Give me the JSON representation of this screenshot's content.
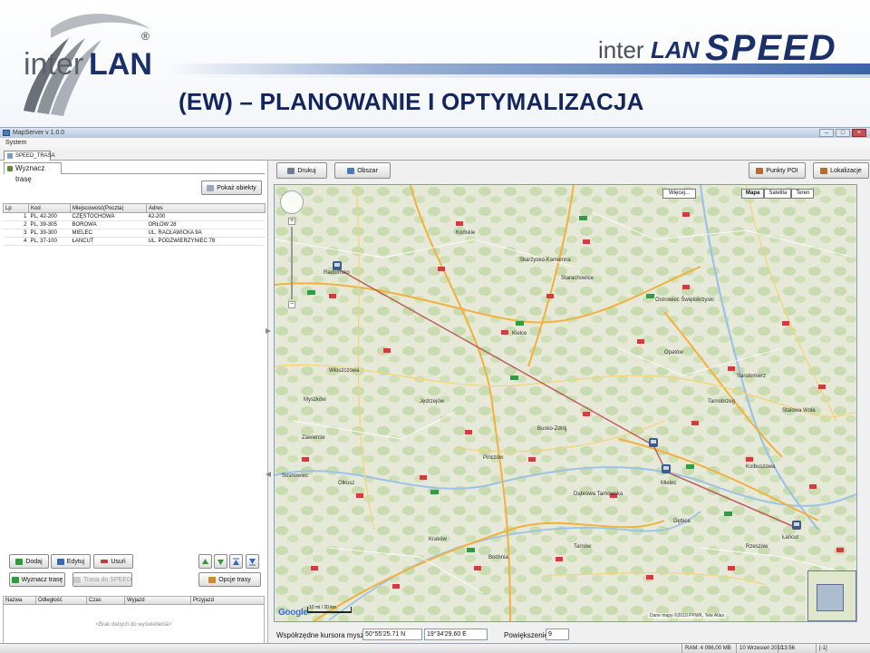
{
  "slide": {
    "title": "(EW) – PLANOWANIE I OPTYMALIZACJA",
    "logo_left_text": "interLAN",
    "logo_left_registered": "®",
    "logo_right_text": "interLAN SPEED"
  },
  "window": {
    "title": "MapServer v 1.0.0",
    "menu": "System",
    "tab": "SPEED_TRASA"
  },
  "left_panel": {
    "tab_label": "Wyznacz trasę",
    "show_objects_label": "Pokaż obiekty",
    "table": {
      "columns": [
        "Lp",
        "Kod",
        "Miejscowość(Poczta)",
        "Adres"
      ],
      "rows": [
        [
          "1",
          "PL, 42-200",
          "CZĘSTOCHOWA",
          "42-200"
        ],
        [
          "2",
          "PL, 39-305",
          "BOROWA",
          "ORŁÓW 28"
        ],
        [
          "3",
          "PL, 39-300",
          "MIELEC",
          "UL. RACŁAWICKA 9A"
        ],
        [
          "4",
          "PL, 37-100",
          "ŁAŃCUT",
          "UL. PODZWIERZYNIEC 78"
        ]
      ]
    },
    "buttons": {
      "add": "Dodaj",
      "edit": "Edytuj",
      "delete": "Usuń",
      "plan_route": "Wyznacz trasę",
      "send_route": "Trasa do SPEED",
      "route_options": "Opcje trasy"
    },
    "results": {
      "columns": [
        "Nazwa",
        "Odległość",
        "Czas",
        "Wyjazd",
        "Przyjazd"
      ],
      "empty_text": "<Brak danych do wyświetlenia>"
    }
  },
  "map_toolbar": {
    "print": "Drukuj",
    "view": "Obszar",
    "poi": "Punkty POI",
    "locate": "Lokalizacje"
  },
  "map": {
    "label_box": "Więcej...",
    "types": [
      "Mapa",
      "Satelita",
      "Teren"
    ],
    "active_type": "Mapa",
    "google": "Google",
    "copyright": "Dane mapy ©2010 PPWK, Tele Atlas",
    "scale": "10 mi / 20 km",
    "cities": [
      {
        "name": "Radomsko"
      },
      {
        "name": "Kielce"
      },
      {
        "name": "Ostrowiec Świętokrzyski"
      },
      {
        "name": "Sandomierz"
      },
      {
        "name": "Tarnobrzeg"
      },
      {
        "name": "Mielec"
      },
      {
        "name": "Rzeszów"
      },
      {
        "name": "Łańcut"
      },
      {
        "name": "Kraków"
      },
      {
        "name": "Tarnów"
      },
      {
        "name": "Busko-Zdrój"
      },
      {
        "name": "Jędrzejów"
      },
      {
        "name": "Włoszczowa"
      },
      {
        "name": "Końskie"
      },
      {
        "name": "Skarżysko-Kamienna"
      },
      {
        "name": "Starachowice"
      },
      {
        "name": "Dąbrowa Tarnowska"
      },
      {
        "name": "Bochnia"
      },
      {
        "name": "Sosnowiec"
      },
      {
        "name": "Myszków"
      },
      {
        "name": "Pińczów"
      },
      {
        "name": "Kolbuszowa"
      },
      {
        "name": "Stalowa Wola"
      },
      {
        "name": "Opatów"
      },
      {
        "name": "Dębica"
      },
      {
        "name": "Olkusz"
      },
      {
        "name": "Zawiercie"
      }
    ]
  },
  "coords": {
    "label": "Współrzędne kursora myszy:",
    "lat": "50°55'25.71 N",
    "lon": "19°34'29.60 E",
    "zoom_label": "Powiększenie:",
    "zoom_value": "9"
  },
  "status_bar": {
    "ram": "RAM: 4 096,00 MB",
    "date": "10 Wrzesień 2010",
    "time": "13:56",
    "extra": "[-1]"
  },
  "colors": {
    "title": "#13255f",
    "route": "#b54848",
    "accent": "#3c64a8"
  }
}
